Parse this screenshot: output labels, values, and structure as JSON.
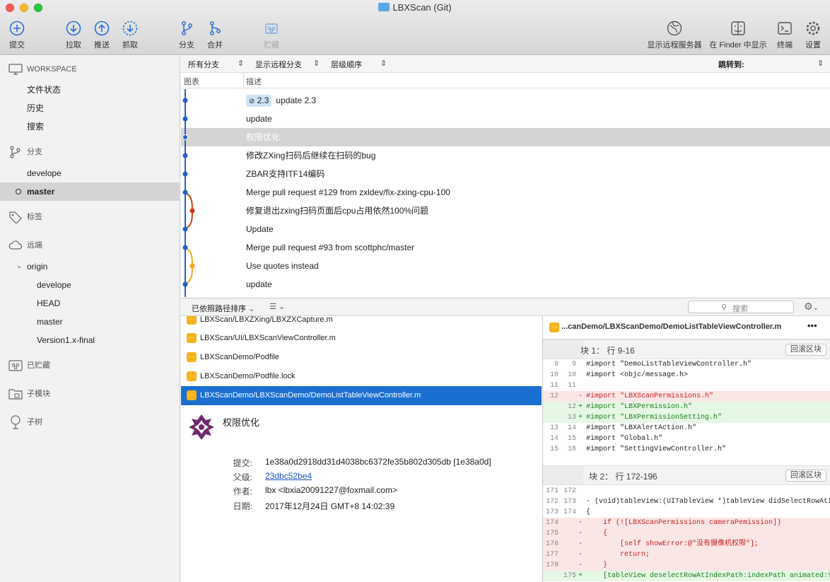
{
  "window": {
    "title": "LBXScan (Git)"
  },
  "toolbar": {
    "commit": "提交",
    "pull": "拉取",
    "push": "推送",
    "fetch": "抓取",
    "branch": "分支",
    "merge": "合并",
    "stash": "贮藏",
    "show_remote": "显示远程服务器",
    "finder": "在 Finder 中显示",
    "terminal": "终端",
    "settings": "设置"
  },
  "sidebar": {
    "workspace": "WORKSPACE",
    "file_status": "文件状态",
    "history": "历史",
    "search": "搜索",
    "branches": "分支",
    "branch_items": [
      "develope",
      "master"
    ],
    "tags": "标签",
    "remotes": "远端",
    "origin": "origin",
    "origin_items": [
      "develope",
      "HEAD",
      "master",
      "Version1.x-final"
    ],
    "stashes": "已贮藏",
    "submodules": "子模块",
    "subtrees": "子树"
  },
  "history": {
    "filter_all_branches": "所有分支",
    "filter_remote_branches": "显示远程分支",
    "filter_order": "层级顺序",
    "jump_to": "跳转到:",
    "col_graph": "图表",
    "col_desc": "描述",
    "commits": [
      {
        "tag": "2.3",
        "message": "update 2.3"
      },
      {
        "message": "update"
      },
      {
        "message": "权限优化"
      },
      {
        "message": "修改ZXing扫码后继续在扫码的bug"
      },
      {
        "message": "ZBAR支持ITF14编码"
      },
      {
        "message": "Merge pull request #129 from zxldev/fix-zxing-cpu-100"
      },
      {
        "message": "修复退出zxing扫码页面后cpu占用依然100%问题"
      },
      {
        "message": "Update"
      },
      {
        "message": "Merge pull request #93 from scottphc/master"
      },
      {
        "message": "Use quotes instead"
      },
      {
        "message": "update"
      }
    ],
    "graph_colors": {
      "main": "#1f63c6",
      "branch1": "#c9401a",
      "branch2": "#f5a623"
    }
  },
  "files": {
    "sort_label": "已依照路径排序",
    "search_placeholder": "搜索",
    "items": [
      "LBXScan/LBXZXing/LBXZXCapture.m",
      "LBXScan/UI/LBXScanViewController.m",
      "LBXScanDemo/Podfile",
      "LBXScanDemo/Podfile.lock",
      "LBXScanDemo/LBXScanDemo/DemoListTableViewController.m"
    ],
    "badge": "···"
  },
  "commit_detail": {
    "message": "权限优化",
    "commit_label": "提交:",
    "commit_value": "1e38a0d2918dd31d4038bc6372fe35b802d305db [1e38a0d]",
    "parent_label": "父级:",
    "parent_value": "23dbc52be4",
    "author_label": "作者:",
    "author_value": "lbx <lbxia20091227@foxmail.com>",
    "date_label": "日期:",
    "date_value": "2017年12月24日 GMT+8 14:02:39"
  },
  "diff": {
    "file": "...canDemo/LBXScanDemo/DemoListTableViewController.m",
    "more": "•••",
    "revert": "回滚区块",
    "hunk1": {
      "label": "块 1：  行 9-16"
    },
    "hunk1_lines": [
      [
        "9",
        "9",
        "",
        "#import \"DemoListTableViewController.h\"",
        "ctx"
      ],
      [
        "10",
        "10",
        "",
        "#import <objc/message.h>",
        "ctx"
      ],
      [
        "11",
        "11",
        "",
        "",
        "ctx"
      ],
      [
        "12",
        "",
        "-",
        "#import \"LBXScanPermissions.h\"",
        "del"
      ],
      [
        "",
        "12",
        "+",
        "#import \"LBXPermission.h\"",
        "add"
      ],
      [
        "",
        "13",
        "+",
        "#import \"LBXPermissionSetting.h\"",
        "add"
      ],
      [
        "13",
        "14",
        "",
        "#import \"LBXAlertAction.h\"",
        "ctx"
      ],
      [
        "14",
        "15",
        "",
        "#import \"Global.h\"",
        "ctx"
      ],
      [
        "15",
        "16",
        "",
        "#import \"SettingViewController.h\"",
        "ctx"
      ]
    ],
    "hunk2": {
      "label": "块 2：  行 172-196"
    },
    "hunk2_lines": [
      [
        "171",
        "172",
        "",
        "",
        "ctx"
      ],
      [
        "172",
        "173",
        "",
        "- (void)tableView:(UITableView *)tableView didSelectRowAtIndexPath:(NSIndexPath *)indexPath",
        "ctx"
      ],
      [
        "173",
        "174",
        "",
        "{",
        "ctx"
      ],
      [
        "174",
        "",
        "-",
        "    if (![LBXScanPermissions cameraPemission])",
        "del"
      ],
      [
        "175",
        "",
        "-",
        "    {",
        "del"
      ],
      [
        "176",
        "",
        "-",
        "        [self showError:@\"没有摄像机权限\"];",
        "del"
      ],
      [
        "177",
        "",
        "-",
        "        return;",
        "del"
      ],
      [
        "178",
        "",
        "-",
        "    }",
        "del"
      ],
      [
        "",
        "175",
        "+",
        "    [tableView deselectRowAtIndexPath:indexPath animated:YES];",
        "add"
      ]
    ]
  }
}
